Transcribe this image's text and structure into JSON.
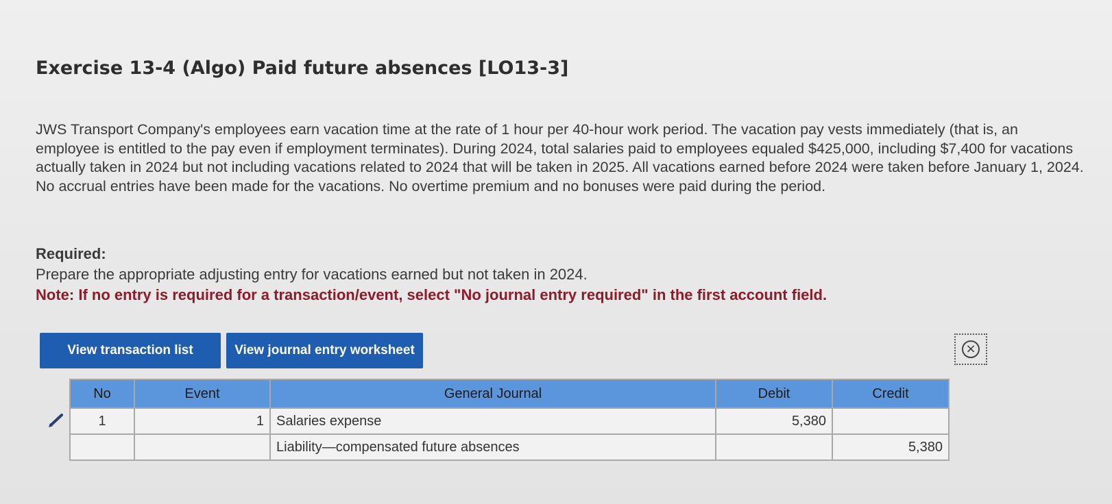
{
  "title": "Exercise 13-4 (Algo) Paid future absences [LO13-3]",
  "problem_text": "JWS Transport Company's employees earn vacation time at the rate of 1 hour per 40-hour work period. The vacation pay vests immediately (that is, an employee is entitled to the pay even if employment terminates). During 2024, total salaries paid to employees equaled $425,000, including $7,400 for vacations actually taken in 2024 but not including vacations related to 2024 that will be taken in 2025. All vacations earned before 2024 were taken before January 1, 2024. No accrual entries have been made for the vacations. No overtime premium and no bonuses were paid during the period.",
  "required": {
    "heading": "Required:",
    "instruction": "Prepare the appropriate adjusting entry for vacations earned but not taken in 2024.",
    "note": "Note: If no entry is required for a transaction/event, select \"No journal entry required\" in the first account field."
  },
  "buttons": {
    "view_transaction_list": "View transaction list",
    "view_journal_entry_worksheet": "View journal entry worksheet"
  },
  "icons": {
    "close": "close-circle-icon",
    "edit": "pencil-icon"
  },
  "table": {
    "headers": {
      "no": "No",
      "event": "Event",
      "general_journal": "General Journal",
      "debit": "Debit",
      "credit": "Credit"
    },
    "rows": [
      {
        "no": "1",
        "event": "1",
        "account": "Salaries expense",
        "debit": "5,380",
        "credit": ""
      },
      {
        "no": "",
        "event": "",
        "account": "Liability—compensated future absences",
        "debit": "",
        "credit": "5,380"
      }
    ]
  },
  "colors": {
    "button_blue": "#1f5db0",
    "header_blue": "#5b95dc",
    "note_red": "#8e1b2a"
  }
}
